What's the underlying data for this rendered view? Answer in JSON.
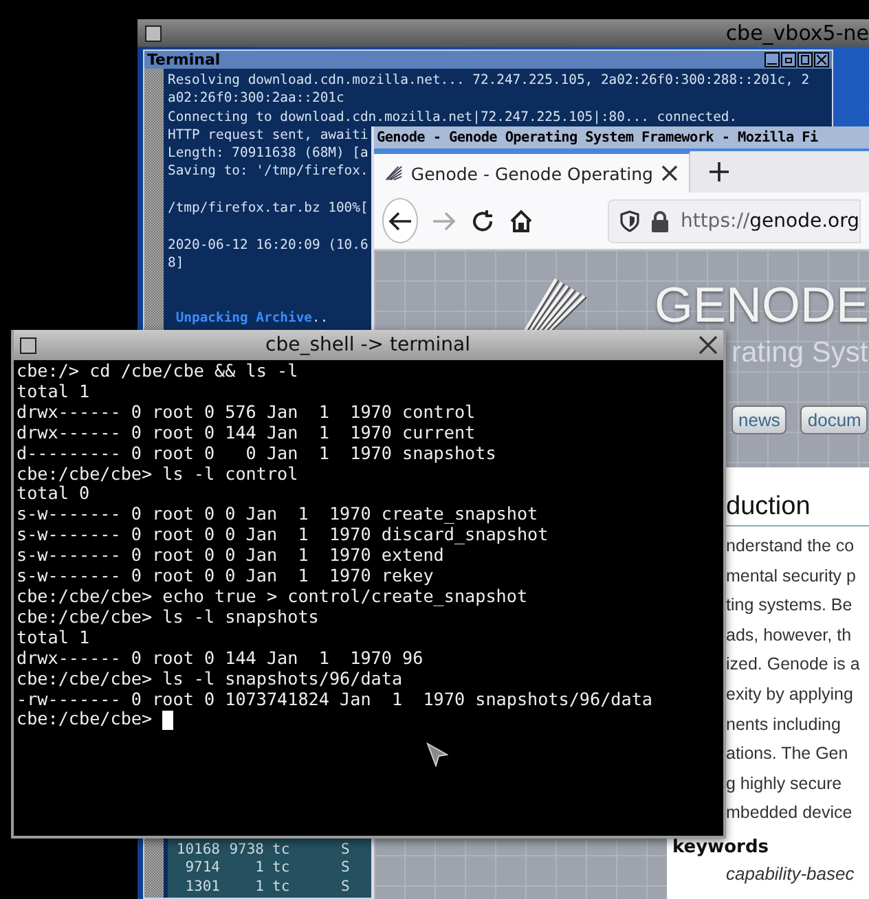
{
  "vbox_window": {
    "title": "cbe_vbox5-ne"
  },
  "terminal_window": {
    "title": "Terminal",
    "lines": [
      {
        "kind": "text",
        "text": "Resolving download.cdn.mozilla.net... 72.247.225.105, 2a02:26f0:300:288::201c, 2"
      },
      {
        "kind": "text",
        "text": "a02:26f0:300:2aa::201c"
      },
      {
        "kind": "text",
        "text": "Connecting to download.cdn.mozilla.net|72.247.225.105|:80... connected."
      },
      {
        "kind": "text",
        "text": "HTTP request sent, awaiti"
      },
      {
        "kind": "text",
        "text": "Length: 70911638 (68M) [a"
      },
      {
        "kind": "text",
        "text": "Saving to: '/tmp/firefox."
      },
      {
        "kind": "blank"
      },
      {
        "kind": "text",
        "text": "/tmp/firefox.tar.bz 100%["
      },
      {
        "kind": "blank"
      },
      {
        "kind": "text",
        "text": "2020-06-12 16:20:09 (10.6"
      },
      {
        "kind": "text",
        "text": "8]"
      },
      {
        "kind": "blank"
      },
      {
        "kind": "blank"
      },
      {
        "kind": "text",
        "text": " **Unpacking Archive**.."
      }
    ],
    "process_rows": [
      [
        "10168",
        "9738",
        "tc",
        "S"
      ],
      [
        "9714",
        "1",
        "tc",
        "S"
      ],
      [
        "1301",
        "1",
        "tc",
        "S"
      ]
    ]
  },
  "browser": {
    "title": "Genode - Genode Operating System Framework - Mozilla Fi",
    "tabs": [
      {
        "title": "Genode - Genode Operating",
        "selected": true
      }
    ],
    "url": {
      "scheme": "https://",
      "host": "genode.org"
    },
    "banner": {
      "logo_text": "GENODE",
      "subtitle": "rating Syst"
    },
    "nav_links": [
      "news",
      "docum"
    ],
    "heading": "duction",
    "paragraph_lines": [
      "nderstand the co",
      "mental security p",
      "ting systems. Be",
      "ads, however, th",
      "ized. Genode is a",
      "exity by applying",
      "nents including",
      "ations. The Gen",
      "g highly secure",
      "mbedded device"
    ],
    "keywords_label": "keywords",
    "keywords": "capability-basec"
  },
  "shell": {
    "title": "cbe_shell -> terminal",
    "lines": [
      "cbe:/> cd /cbe/cbe && ls -l",
      "total 1",
      "drwx------ 0 root 0 576 Jan  1  1970 control",
      "drwx------ 0 root 0 144 Jan  1  1970 current",
      "d--------- 0 root 0   0 Jan  1  1970 snapshots",
      "cbe:/cbe/cbe> ls -l control",
      "total 0",
      "s-w------- 0 root 0 0 Jan  1  1970 create_snapshot",
      "s-w------- 0 root 0 0 Jan  1  1970 discard_snapshot",
      "s-w------- 0 root 0 0 Jan  1  1970 extend",
      "s-w------- 0 root 0 0 Jan  1  1970 rekey",
      "cbe:/cbe/cbe> echo true > control/create_snapshot",
      "cbe:/cbe/cbe> ls -l snapshots",
      "total 1",
      "drwx------ 0 root 0 144 Jan  1  1970 96",
      "cbe:/cbe/cbe> ls -l snapshots/96/data",
      "-rw------- 0 root 0 1073741824 Jan  1  1970 snapshots/96/data"
    ],
    "prompt": "cbe:/cbe/cbe>",
    "cursor": true
  }
}
